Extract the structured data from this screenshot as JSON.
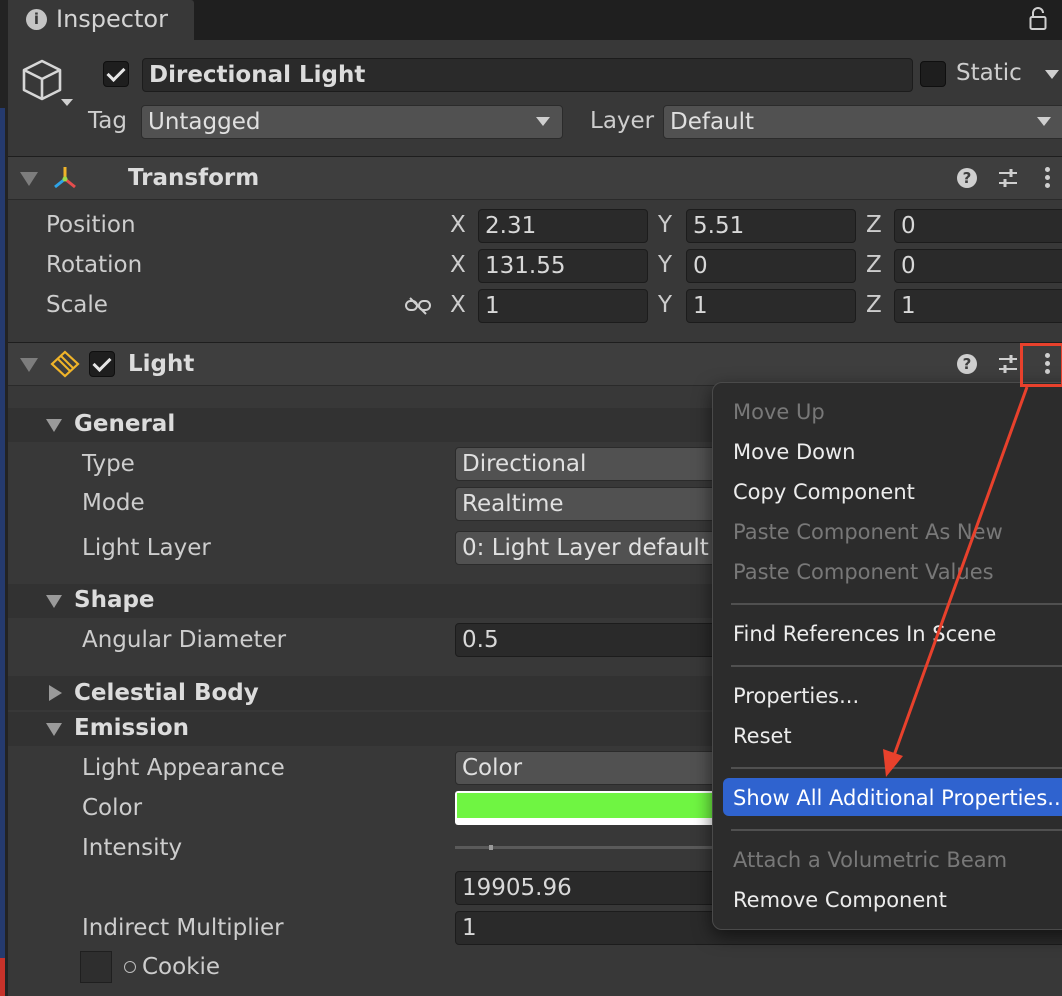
{
  "window": {
    "tab_label": "Inspector"
  },
  "gameobject": {
    "active": true,
    "name": "Directional Light",
    "static_label": "Static",
    "static": false,
    "tag_label": "Tag",
    "tag_value": "Untagged",
    "layer_label": "Layer",
    "layer_value": "Default"
  },
  "transform": {
    "title": "Transform",
    "rows": [
      {
        "label": "Position",
        "x": "2.31",
        "y": "5.51",
        "z": "0"
      },
      {
        "label": "Rotation",
        "x": "131.55",
        "y": "0",
        "z": "0"
      },
      {
        "label": "Scale",
        "x": "1",
        "y": "1",
        "z": "1"
      }
    ],
    "axis_x": "X",
    "axis_y": "Y",
    "axis_z": "Z"
  },
  "light": {
    "title": "Light",
    "enabled": true,
    "general": {
      "title": "General",
      "type_label": "Type",
      "type_value": "Directional",
      "mode_label": "Mode",
      "mode_value": "Realtime",
      "layer_label": "Light Layer",
      "layer_value": "0: Light Layer default"
    },
    "shape": {
      "title": "Shape",
      "angular_label": "Angular Diameter",
      "angular_value": "0.5"
    },
    "celestial": {
      "title": "Celestial Body"
    },
    "emission": {
      "title": "Emission",
      "appearance_label": "Light Appearance",
      "appearance_value": "Color",
      "color_label": "Color",
      "color_value": "#6ff542",
      "intensity_label": "Intensity",
      "intensity_value": "19905.96",
      "indirect_label": "Indirect Multiplier",
      "indirect_value": "1",
      "cookie_label": "Cookie"
    }
  },
  "context_menu": {
    "move_up": "Move Up",
    "move_down": "Move Down",
    "copy_component": "Copy Component",
    "paste_as_new": "Paste Component As New",
    "paste_values": "Paste Component Values",
    "find_references": "Find References In Scene",
    "properties": "Properties...",
    "reset": "Reset",
    "show_all": "Show All Additional Properties...",
    "attach_beam": "Attach a Volumetric Beam",
    "remove_component": "Remove Component"
  },
  "colors": {
    "accent": "#2f63cf",
    "annotation": "#e8412c",
    "panel": "#383838"
  }
}
